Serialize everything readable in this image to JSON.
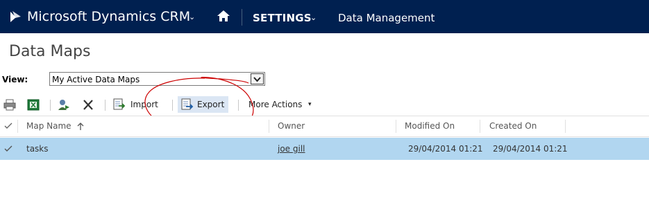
{
  "topbar": {
    "app_title": "Microsoft Dynamics CRM",
    "section": "SETTINGS",
    "breadcrumb": "Data Management",
    "background": "#002050"
  },
  "page": {
    "title": "Data Maps"
  },
  "view": {
    "label": "View:",
    "selected": "My Active Data Maps"
  },
  "toolbar": {
    "import_label": "Import",
    "export_label": "Export",
    "more_actions_label": "More Actions"
  },
  "grid": {
    "columns": {
      "map_name": "Map Name",
      "owner": "Owner",
      "modified_on": "Modified On",
      "created_on": "Created On"
    },
    "rows": [
      {
        "map_name": "tasks",
        "owner": "joe gill",
        "modified_on": "29/04/2014 01:21",
        "created_on": "29/04/2014 01:21"
      }
    ],
    "selected_row_color": "#b1d6f0"
  },
  "annotation": {
    "color": "#cc0000"
  }
}
